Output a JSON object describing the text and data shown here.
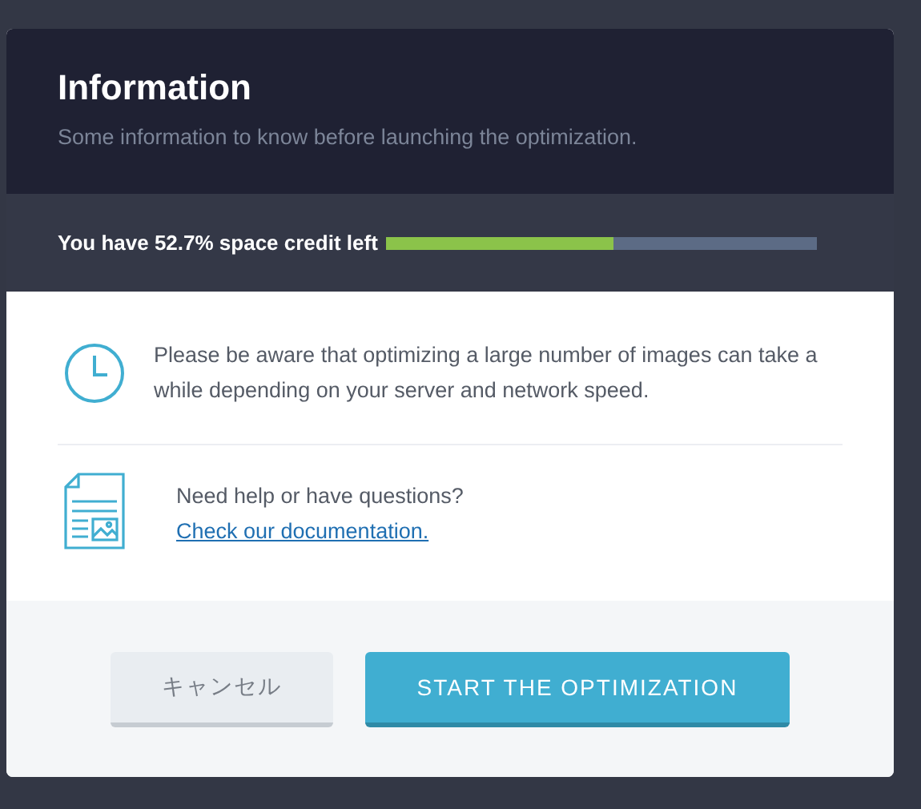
{
  "dialog": {
    "title": "Information",
    "subtitle": "Some information to know before launching the optimization."
  },
  "credit": {
    "label": "You have 52.7% space credit left",
    "level": 0.527
  },
  "notices": [
    {
      "kind": "clock",
      "text": "Please be aware that optimizing a large number of images can take a while depending on your server and network speed."
    },
    {
      "kind": "document",
      "text": "Need help or have questions?",
      "link": "Check our documentation."
    }
  ],
  "buttons": [
    {
      "kind": "secondary",
      "label": "キャンセル"
    },
    {
      "kind": "primary",
      "label": "START THE OPTIMIZATION"
    }
  ]
}
